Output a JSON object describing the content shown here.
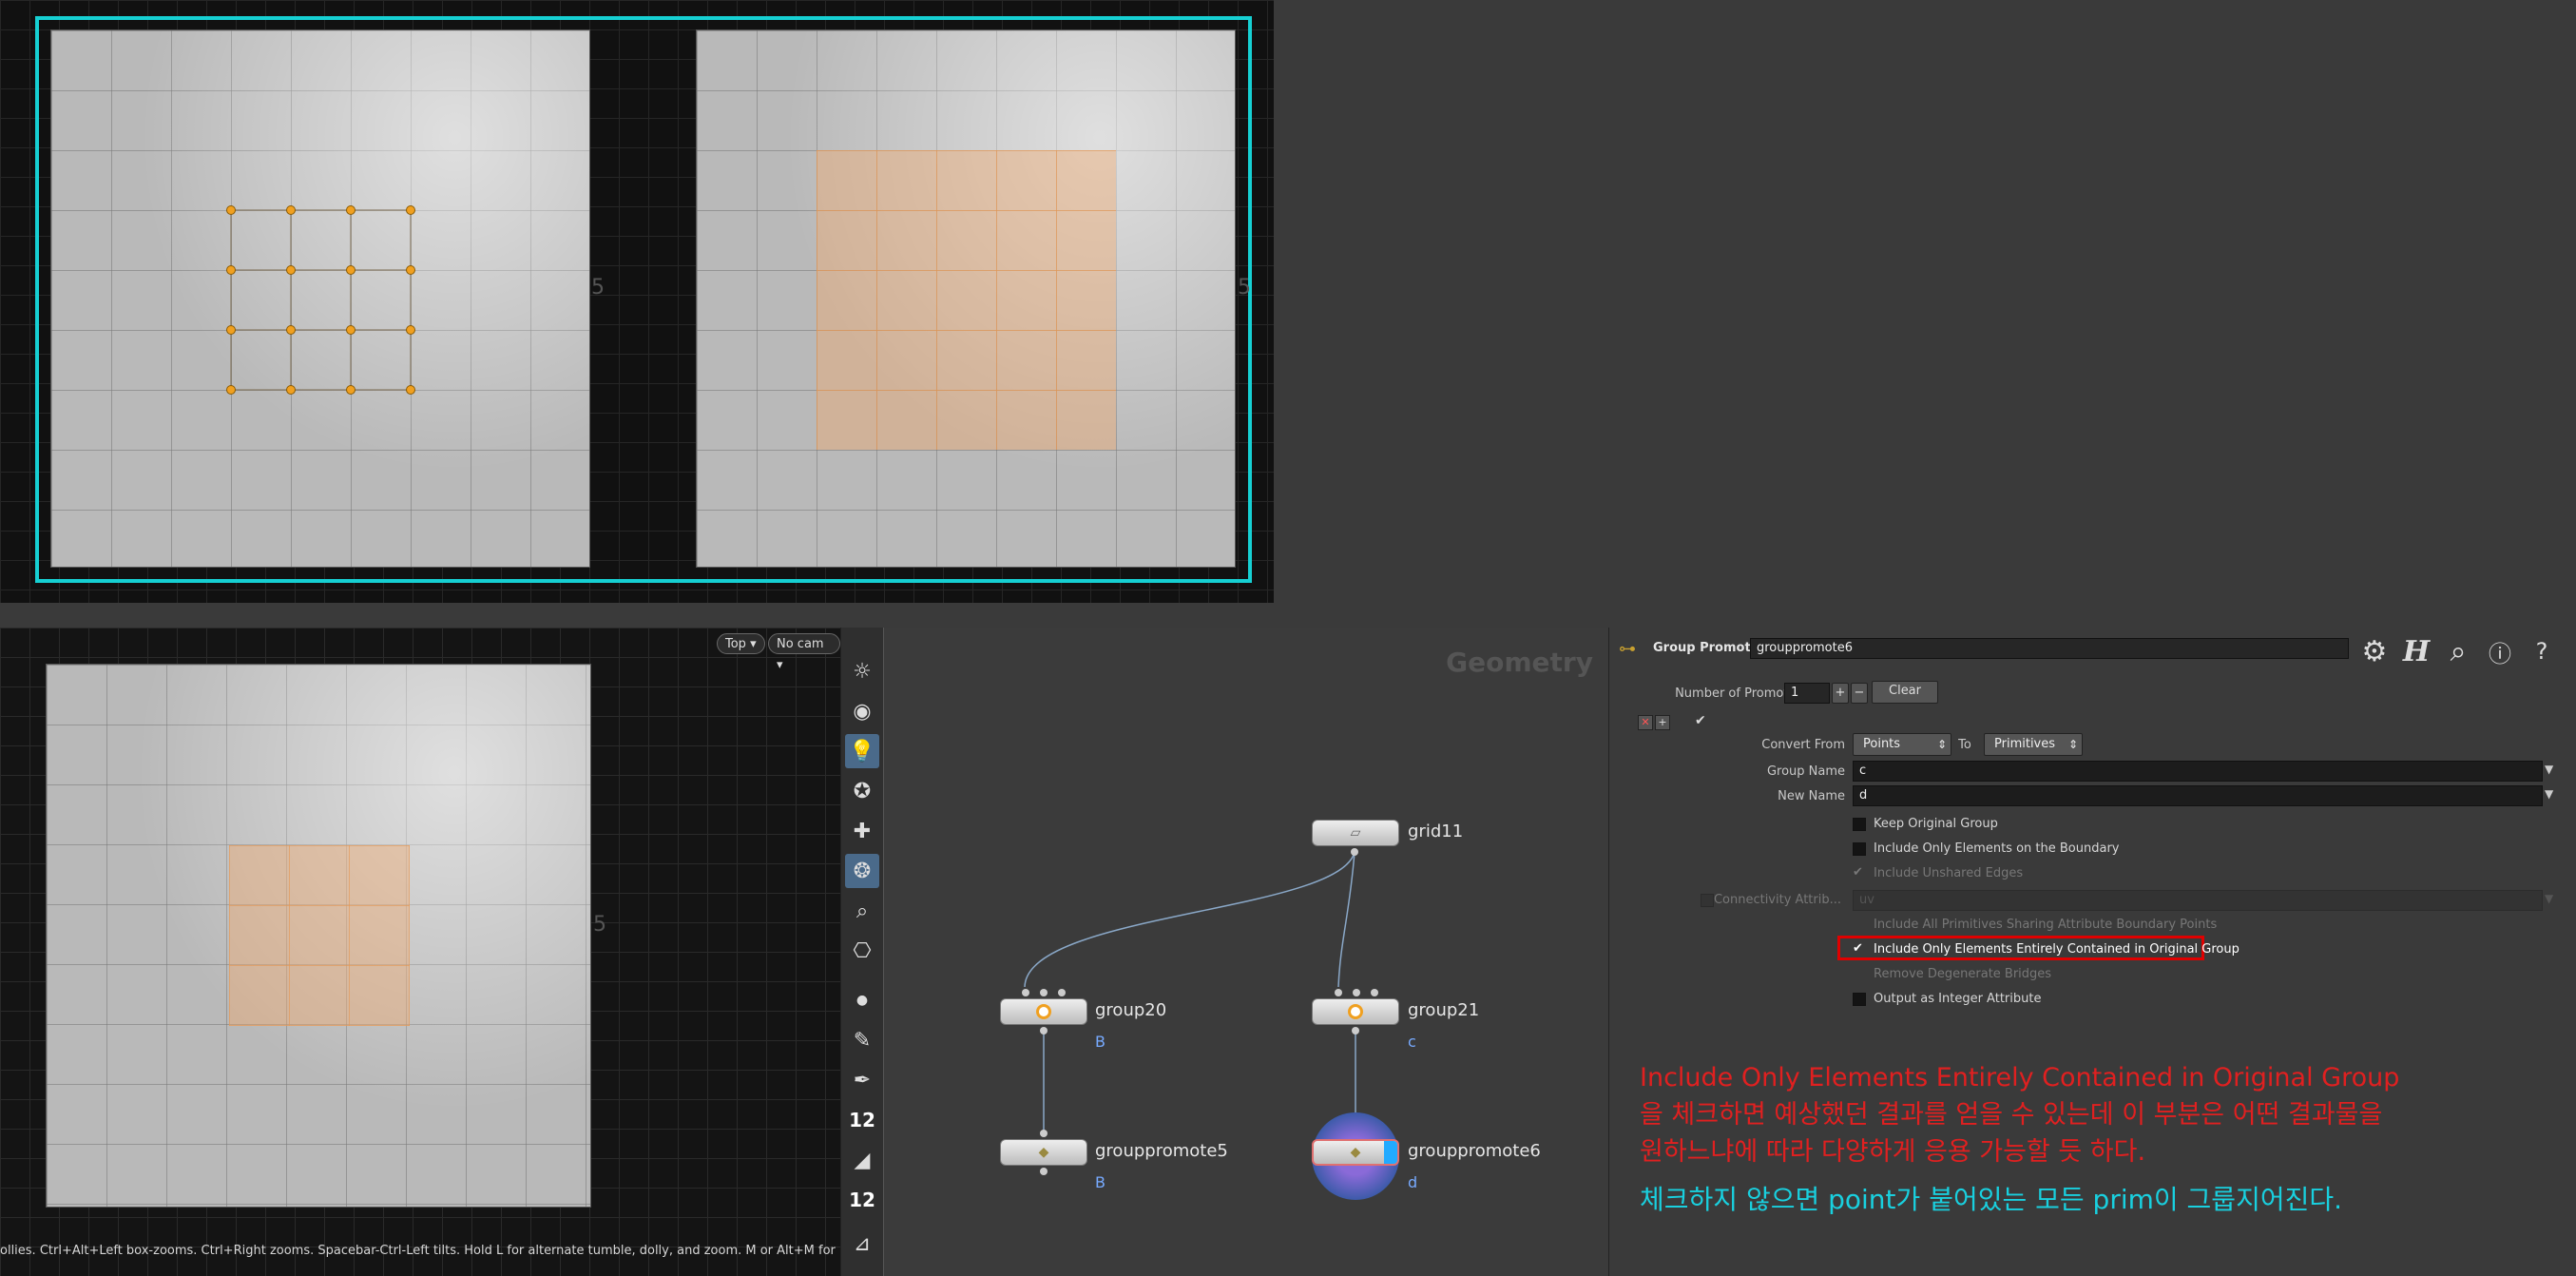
{
  "viewport_top": {
    "axis_labels": [
      "5",
      "5"
    ]
  },
  "viewport_bottom": {
    "top_menu": "Top",
    "cam_menu": "No cam",
    "axis_label": "5",
    "status_text": "ollies. Ctrl+Alt+Left box-zooms. Ctrl+Right zooms. Spacebar-Ctrl-Left tilts. Hold L for alternate tumble, dolly, and zoom.    M or Alt+M for First Person"
  },
  "toolbar": {
    "items": [
      "light-icon",
      "ambient-light-icon",
      "point-light-icon",
      "spot-light-icon",
      "area-light-icon",
      "env-light-icon",
      "camera-icon",
      "stereo-camera-icon",
      "vr-camera-icon",
      "dot-icon",
      "brush-icon",
      "pen-icon"
    ],
    "num_a": "12",
    "num_b": "12"
  },
  "network": {
    "title": "Geometry",
    "nodes": {
      "grid": {
        "name": "grid11"
      },
      "group20": {
        "name": "group20",
        "sub": "B"
      },
      "group21": {
        "name": "group21",
        "sub": "c"
      },
      "gp5": {
        "name": "grouppromote5",
        "sub": "B"
      },
      "gp6": {
        "name": "grouppromote6",
        "sub": "d"
      }
    }
  },
  "params": {
    "node_type": "Group Promote",
    "node_name": "grouppromote6",
    "num_promotions_label": "Number of Promotions",
    "num_promotions_value": "1",
    "plus": "+",
    "minus": "−",
    "clear_label": "Clear",
    "convert_from_label": "Convert From",
    "convert_from_value": "Points",
    "to_label": "To",
    "to_value": "Primitives",
    "group_name_label": "Group Name",
    "group_name_value": "c",
    "new_name_label": "New Name",
    "new_name_value": "d",
    "options": [
      {
        "label": "Keep Original Group",
        "checked": false,
        "enabled": true
      },
      {
        "label": "Include Only Elements on the Boundary",
        "checked": false,
        "enabled": true
      },
      {
        "label": "Include Unshared Edges",
        "checked": true,
        "enabled": false
      }
    ],
    "connectivity_label": "Connectivity Attrib...",
    "connectivity_value": "uv",
    "options2": [
      {
        "label": "Include All Primitives Sharing Attribute Boundary Points",
        "checked": false,
        "enabled": false
      },
      {
        "label": "Include Only Elements Entirely Contained in Original Group",
        "checked": true,
        "enabled": true
      },
      {
        "label": "Remove Degenerate Bridges",
        "checked": false,
        "enabled": false
      },
      {
        "label": "Output as Integer Attribute",
        "checked": false,
        "enabled": true
      }
    ],
    "highlight_color": "#e00000"
  },
  "notes": {
    "red_line1": "Include Only Elements Entirely Contained in Original Group",
    "red_line2": "을 체크하면 예상했던 결과를 얻을 수 있는데 이 부분은 어떤 결과물을",
    "red_line3": "원하느냐에 따라 다양하게 응용 가능할 듯 하다.",
    "cyan_line": "체크하지 않으면 point가 붙어있는 모든 prim이 그룹지어진다."
  },
  "colors": {
    "frame": "#16d0d3",
    "selection": "#f0aa6e",
    "point": "#f0a020",
    "note_red": "#e02020",
    "note_cyan": "#19d0df"
  }
}
